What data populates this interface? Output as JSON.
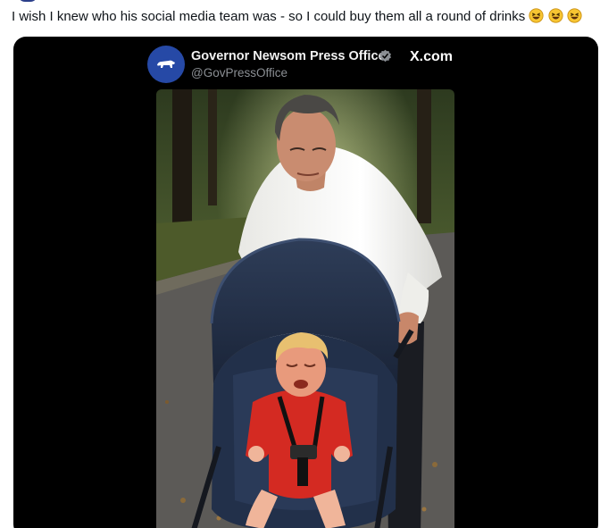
{
  "post": {
    "text": "I wish I knew who his social media team was - so I could buy them all a round of drinks",
    "emoji": [
      "laughing-emoji",
      "laughing-emoji",
      "laughing-emoji"
    ]
  },
  "embedded_tweet": {
    "account_name": "Governor Newsom Press Office",
    "handle": "@GovPressOffice",
    "site_label": "X.com",
    "verified": true,
    "image": {
      "description_icon": "ai-image-man-pushing-stroller-with-crying-baby"
    }
  },
  "colors": {
    "embed_background": "#000000",
    "avatar_blue": "#2649a6",
    "verified_badge": "#8b8f94",
    "handle_gray": "#8b8f94",
    "baby_outfit_red": "#d42a22",
    "stroller_navy": "#1e2a40"
  }
}
